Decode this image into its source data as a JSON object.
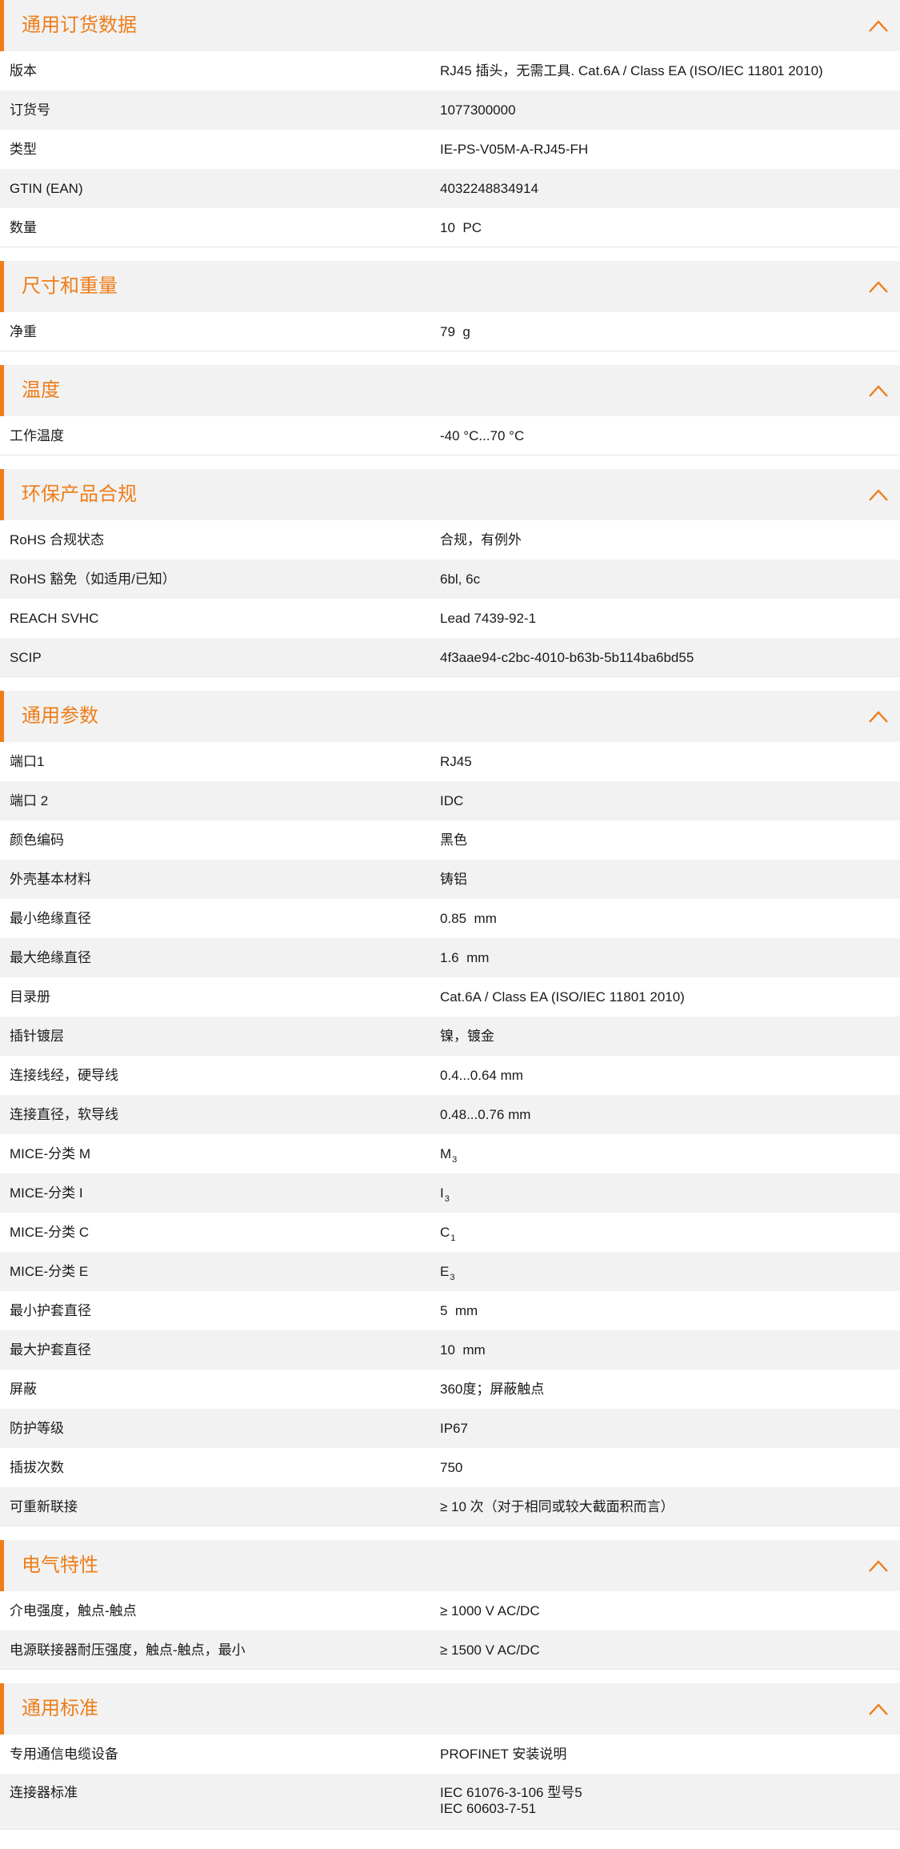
{
  "accent_color": "#ef7d19",
  "sections": [
    {
      "title": "通用订货数据",
      "icon": "chevron-up-icon",
      "rows": [
        {
          "label": "版本",
          "value": "RJ45 插头，无需工具. Cat.6A / Class EA (ISO/IEC 11801 2010)"
        },
        {
          "label": "订货号",
          "value": "1077300000"
        },
        {
          "label": "类型",
          "value": "IE-PS-V05M-A-RJ45-FH"
        },
        {
          "label": "GTIN (EAN)",
          "value": "4032248834914"
        },
        {
          "label": "数量",
          "value": "10  PC"
        }
      ]
    },
    {
      "title": "尺寸和重量",
      "icon": "chevron-up-icon",
      "rows": [
        {
          "label": "净重",
          "value": "79  g"
        }
      ]
    },
    {
      "title": "温度",
      "icon": "chevron-up-icon",
      "rows": [
        {
          "label": "工作温度",
          "value": "-40 °C...70 °C"
        }
      ]
    },
    {
      "title": "环保产品合规",
      "icon": "chevron-up-icon",
      "rows": [
        {
          "label": "RoHS 合规状态",
          "value": "合规，有例外"
        },
        {
          "label": "RoHS 豁免（如适用/已知）",
          "value": "6bl, 6c"
        },
        {
          "label": "REACH SVHC",
          "value": "Lead 7439-92-1"
        },
        {
          "label": "SCIP",
          "value": "4f3aae94-c2bc-4010-b63b-5b114ba6bd55"
        }
      ]
    },
    {
      "title": "通用参数",
      "icon": "chevron-up-icon",
      "rows": [
        {
          "label": "端口1",
          "value": "RJ45"
        },
        {
          "label": "端口 2",
          "value": "IDC"
        },
        {
          "label": "颜色编码",
          "value": "黑色"
        },
        {
          "label": "外壳基本材料",
          "value": "铸铝"
        },
        {
          "label": "最小绝缘直径",
          "value": "0.85  mm"
        },
        {
          "label": "最大绝缘直径",
          "value": "1.6  mm"
        },
        {
          "label": "目录册",
          "value": "Cat.6A / Class EA (ISO/IEC 11801 2010)"
        },
        {
          "label": "插针镀层",
          "value": "镍，镀金"
        },
        {
          "label": "连接线经，硬导线",
          "value": "0.4...0.64 mm"
        },
        {
          "label": "连接直径，软导线",
          "value": "0.48...0.76 mm"
        },
        {
          "label": "MICE-分类 M",
          "value": "M",
          "sub": "3"
        },
        {
          "label": "MICE-分类 I",
          "value": "I",
          "sub": "3"
        },
        {
          "label": "MICE-分类 C",
          "value": "C",
          "sub": "1"
        },
        {
          "label": "MICE-分类 E",
          "value": "E",
          "sub": "3"
        },
        {
          "label": "最小护套直径",
          "value": "5  mm"
        },
        {
          "label": "最大护套直径",
          "value": "10  mm"
        },
        {
          "label": "屏蔽",
          "value": "360度；屏蔽触点"
        },
        {
          "label": "防护等级",
          "value": "IP67"
        },
        {
          "label": "插拔次数",
          "value": "750"
        },
        {
          "label": "可重新联接",
          "value": "≥ 10 次（对于相同或较大截面积而言）"
        }
      ]
    },
    {
      "title": "电气特性",
      "icon": "chevron-up-icon",
      "rows": [
        {
          "label": "介电强度，触点-触点",
          "value": "≥ 1000 V AC/DC"
        },
        {
          "label": "电源联接器耐压强度，触点-触点，最小",
          "value": "≥ 1500 V AC/DC"
        }
      ]
    },
    {
      "title": "通用标准",
      "icon": "chevron-up-icon",
      "rows": [
        {
          "label": "专用通信电缆设备",
          "value": "PROFINET 安装说明"
        },
        {
          "label": "连接器标准",
          "value": "IEC 61076-3-106 型号5\nIEC 60603-7-51",
          "tall": true
        }
      ]
    }
  ]
}
